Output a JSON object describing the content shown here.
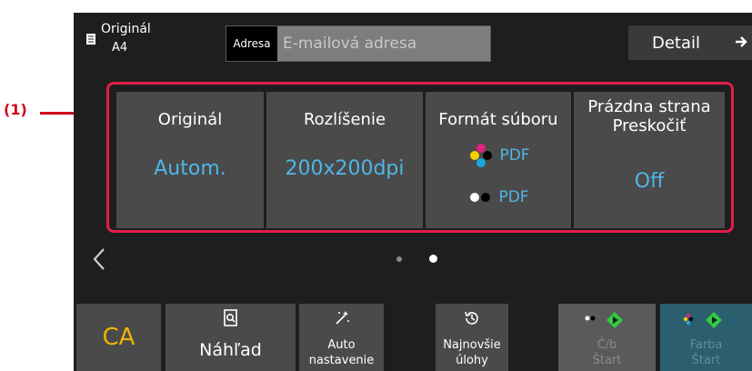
{
  "callout": "(1)",
  "header": {
    "original_label": "Originál",
    "original_size": "A4",
    "address_label": "Adresa",
    "address_placeholder": "E-mailová adresa",
    "detail_label": "Detail"
  },
  "tiles": [
    {
      "title": "Originál",
      "value": "Autom."
    },
    {
      "title": "Rozlíšenie",
      "value": "200x200dpi"
    },
    {
      "title": "Formát súboru",
      "color_format": "PDF",
      "bw_format": "PDF"
    },
    {
      "title_line1": "Prázdna strana",
      "title_line2": "Preskočiť",
      "value": "Off"
    }
  ],
  "pagination": {
    "pages": 2,
    "current": 2
  },
  "bottom": {
    "ca": "CA",
    "preview": "Náhľad",
    "auto_line1": "Auto",
    "auto_line2": "nastavenie",
    "recent_line1": "Najnovšie",
    "recent_line2": "úlohy",
    "bw_start_line1": "Č/b",
    "bw_start_line2": "Štart",
    "color_start_line1": "Farba",
    "color_start_line2": "Štart"
  },
  "colors": {
    "accent_value": "#4fb6e6",
    "callout": "#d0021b",
    "ca": "#f2b300",
    "start_green": "#2ecc40"
  }
}
